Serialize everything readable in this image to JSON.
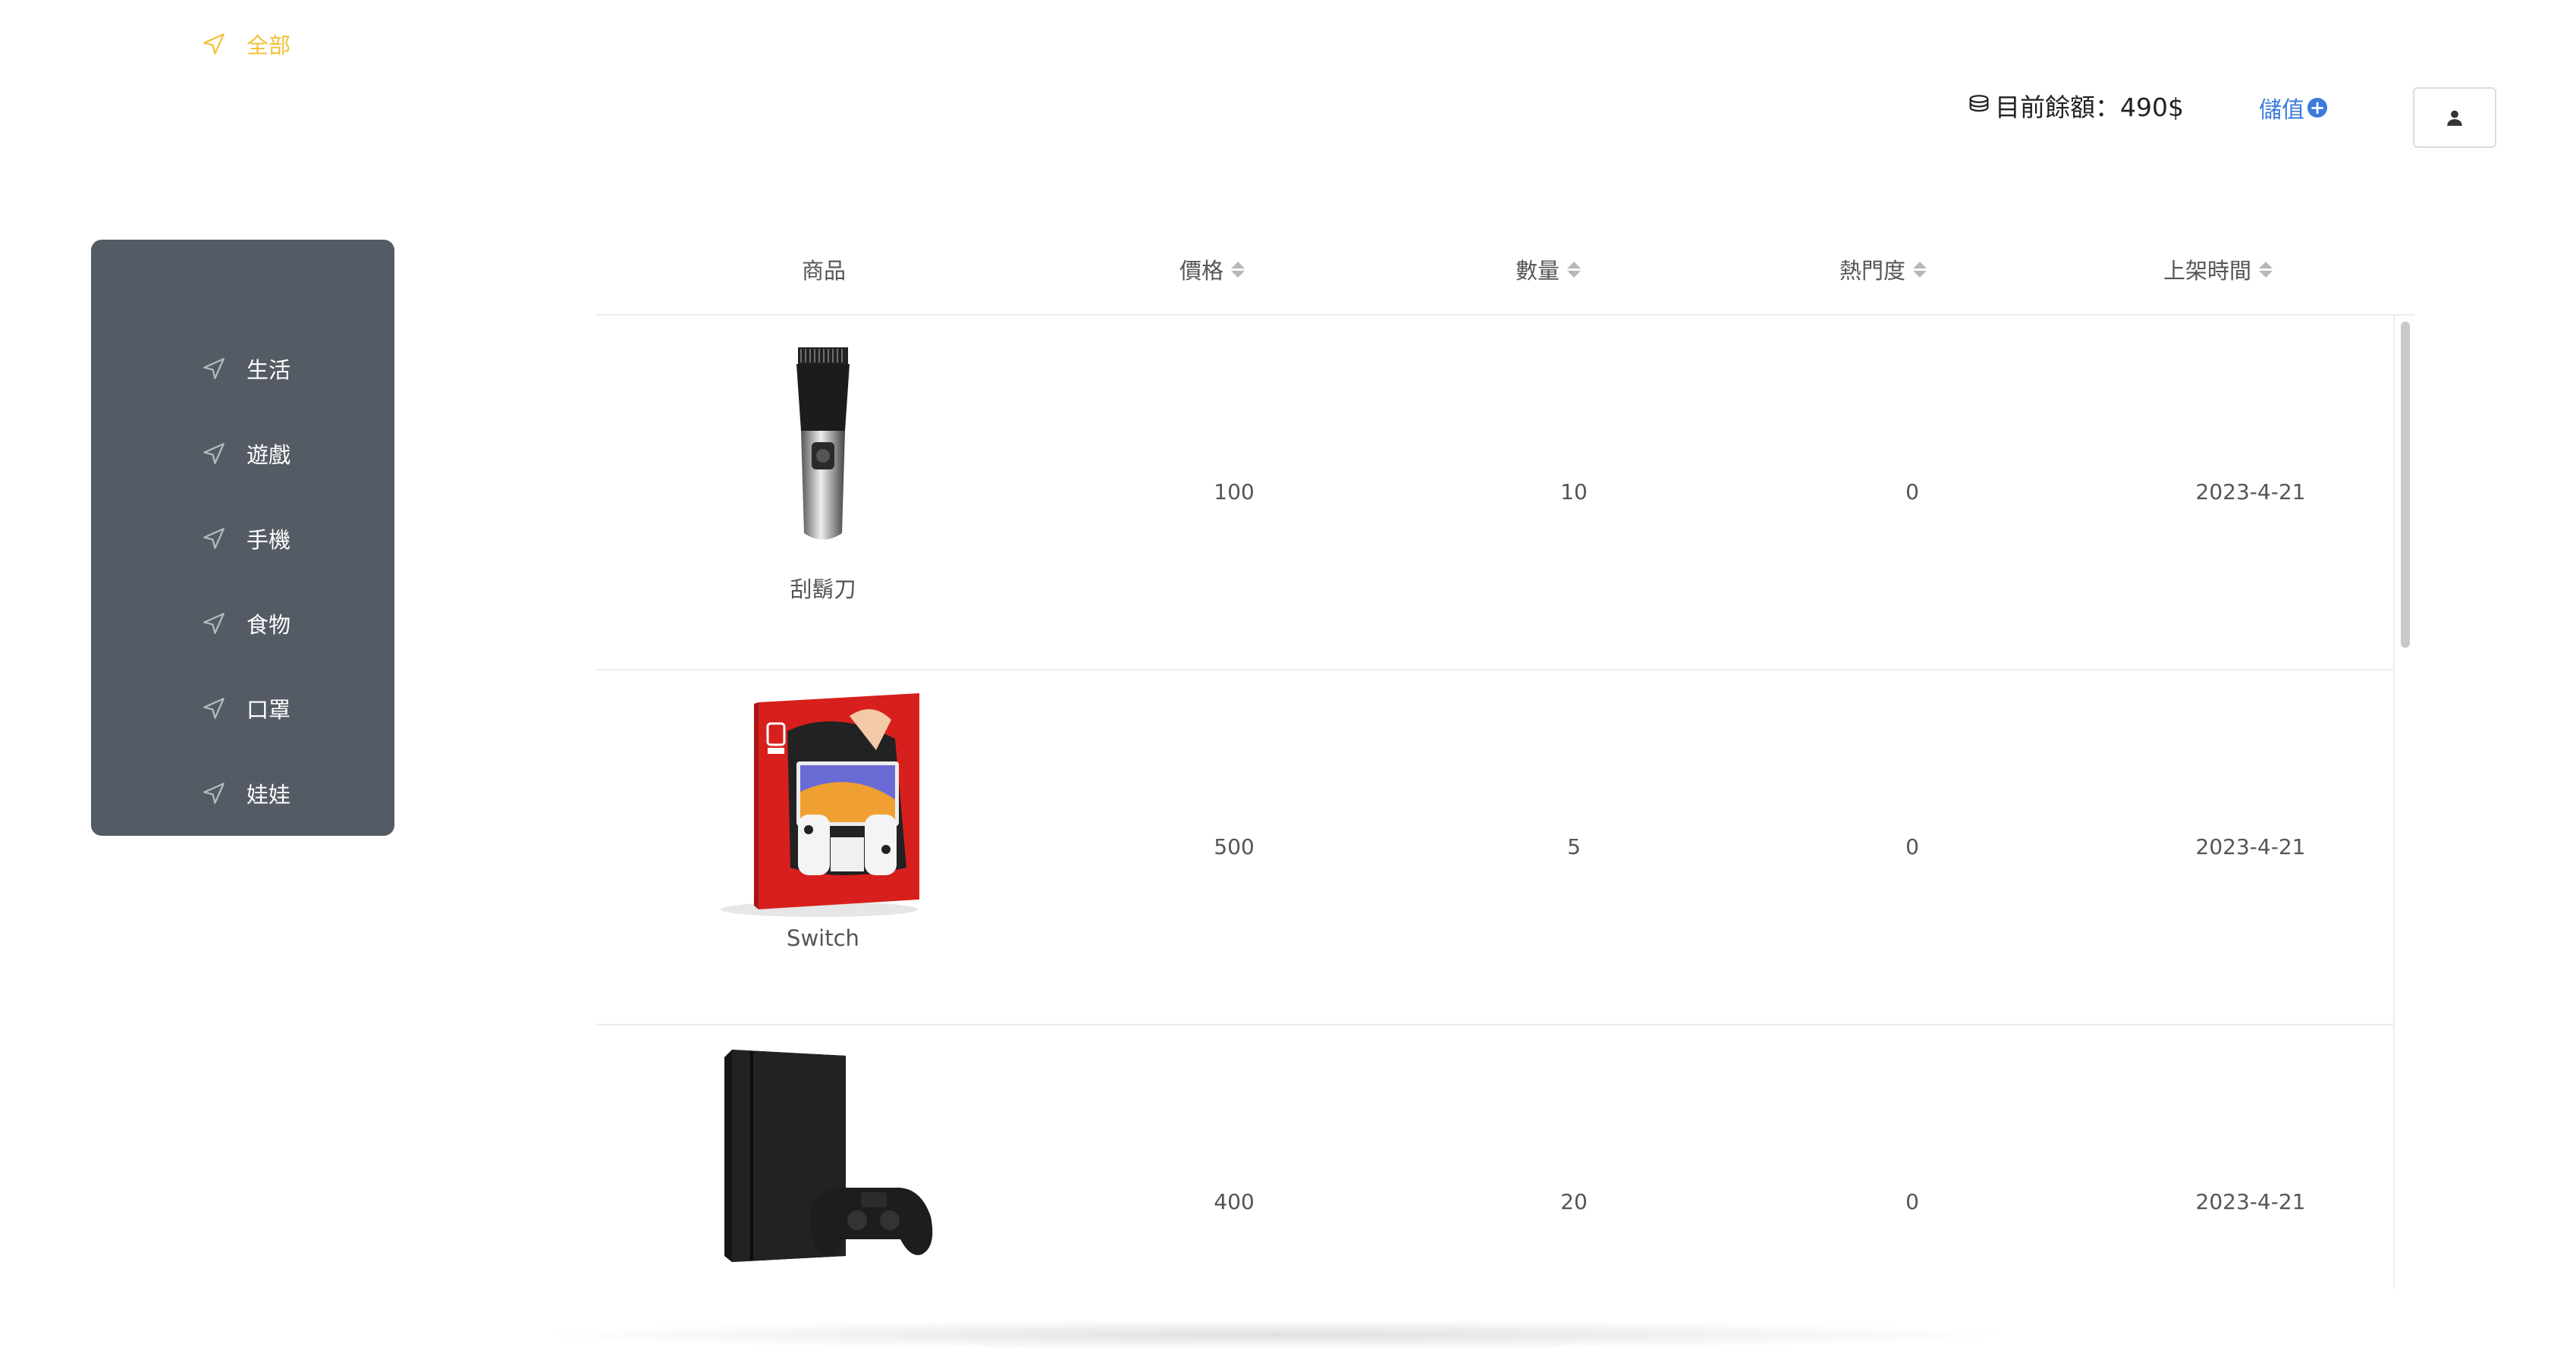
{
  "header": {
    "balance_label": "目前餘額：490$",
    "topup_label": "儲值",
    "coin_icon": "coins-icon",
    "user_icon": "user-icon"
  },
  "sidebar": {
    "items": [
      {
        "label": "全部",
        "active": true
      },
      {
        "label": "生活",
        "active": false
      },
      {
        "label": "遊戲",
        "active": false
      },
      {
        "label": "手機",
        "active": false
      },
      {
        "label": "食物",
        "active": false
      },
      {
        "label": "口罩",
        "active": false
      },
      {
        "label": "娃娃",
        "active": false
      }
    ]
  },
  "table": {
    "columns": [
      "商品",
      "價格",
      "數量",
      "熱門度",
      "上架時間"
    ],
    "rows": [
      {
        "name": "刮鬍刀",
        "price": "100",
        "quantity": "10",
        "popularity": "0",
        "date": "2023-4-21",
        "image": "shaver-image"
      },
      {
        "name": "Switch",
        "price": "500",
        "quantity": "5",
        "popularity": "0",
        "date": "2023-4-21",
        "image": "switch-box-image"
      },
      {
        "name": "",
        "price": "400",
        "quantity": "20",
        "popularity": "0",
        "date": "2023-4-21",
        "image": "ps4-image"
      }
    ]
  },
  "colors": {
    "sidebar_bg": "#545b64",
    "active_item": "#f0c23c",
    "accent_blue": "#3a7bdc"
  }
}
